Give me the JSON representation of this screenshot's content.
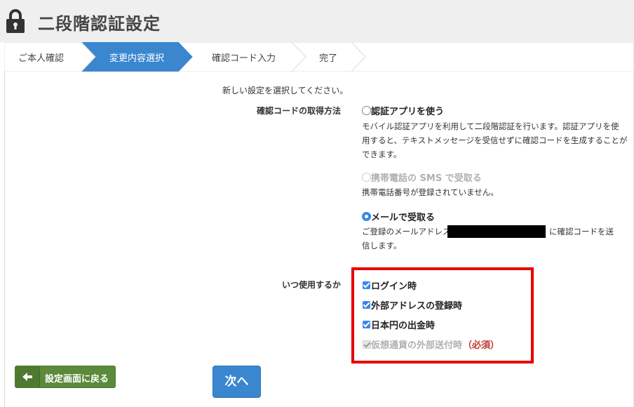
{
  "header": {
    "title": "二段階認証設定",
    "icon": "lock-icon"
  },
  "steps": [
    {
      "label": "ご本人確認",
      "active": false
    },
    {
      "label": "変更内容選択",
      "active": true
    },
    {
      "label": "確認コード入力",
      "active": false
    },
    {
      "label": "完了",
      "active": false
    }
  ],
  "intro": "新しい設定を選択してください。",
  "method": {
    "label": "確認コードの取得方法",
    "options": [
      {
        "title": "認証アプリを使う",
        "desc": [
          "モバイル認証アプリを利用して二段階認証を行います。認証アプリを使",
          "用すると、テキストメッセージを受信せずに確認コードを生成することが",
          "できます。"
        ],
        "state": "unchecked"
      },
      {
        "title": "携帯電話の SMS で受取る",
        "desc": [
          "携帯電話番号が登録されていません。"
        ],
        "state": "disabled"
      },
      {
        "title": "メールで受取る",
        "desc_prefix": "ご登録のメールアドレス",
        "desc_suffix": "に確認コードを送",
        "desc_line2": "信します。",
        "state": "checked"
      }
    ]
  },
  "usage": {
    "label": "いつ使用するか",
    "items": [
      {
        "label": "ログイン時",
        "checked": true,
        "disabled": false
      },
      {
        "label": "外部アドレスの登録時",
        "checked": true,
        "disabled": false
      },
      {
        "label": "日本円の出金時",
        "checked": true,
        "disabled": false
      },
      {
        "label": "仮想通貨の外部送付時",
        "checked": true,
        "disabled": true,
        "suffix": "（必須）"
      }
    ]
  },
  "buttons": {
    "back": "設定画面に戻る",
    "next": "次へ"
  },
  "colors": {
    "accent": "#3a87d0",
    "back_button": "#5a8a3a",
    "highlight": "#e80000",
    "required": "#c0392b"
  }
}
